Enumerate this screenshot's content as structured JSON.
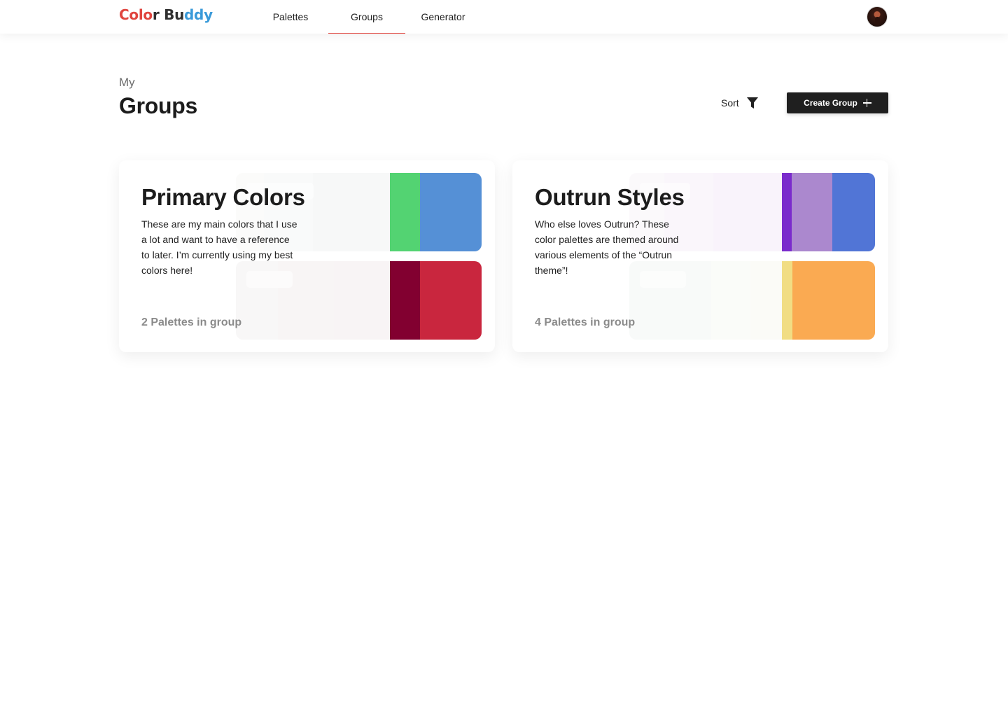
{
  "header": {
    "logo": [
      {
        "ch": "C",
        "color": "#e0453f"
      },
      {
        "ch": "o",
        "color": "#e0453f"
      },
      {
        "ch": "l",
        "color": "#e0453f"
      },
      {
        "ch": "o",
        "color": "#e0453f"
      },
      {
        "ch": "r",
        "color": "#2f2f2f"
      },
      {
        "ch": " ",
        "color": "#2f2f2f"
      },
      {
        "ch": "B",
        "color": "#2f2f2f"
      },
      {
        "ch": "u",
        "color": "#2f2f2f"
      },
      {
        "ch": "d",
        "color": "#3a9ad9"
      },
      {
        "ch": "d",
        "color": "#3a9ad9"
      },
      {
        "ch": "y",
        "color": "#3a9ad9"
      }
    ],
    "nav": {
      "palettes": "Palettes",
      "groups": "Groups",
      "generator": "Generator"
    },
    "active_tab": "Groups"
  },
  "page": {
    "kicker": "My",
    "title": "Groups",
    "sort_label": "Sort",
    "create_label": "Create Group"
  },
  "groups": [
    {
      "title": "Primary Colors",
      "description": "These are my main colors that I use a lot and want to have a reference to later. I’m currently using my best colors here!",
      "count": "2 Palettes in group",
      "palettes": [
        [
          "#fbfbfa",
          "#f9fafa",
          "#f7f8f8",
          "#53d372",
          "#5590d6"
        ],
        [
          "#f8f7f7",
          "#f8f5f5",
          "#f8f4f5",
          "#820030",
          "#c9263e"
        ]
      ]
    },
    {
      "title": "Outrun Styles",
      "description": "Who else loves Outrun? These color palettes are themed around various elements of the “Outrun theme”!",
      "count": "4 Palettes in group",
      "palettes": [
        [
          "#fbf9fb",
          "#faf6fb",
          "#f9f3fb",
          "#7a2bcc",
          "#ab88ce",
          "#5175d6"
        ],
        [
          "#f8faf9",
          "#fafcf9",
          "#fbfbf7",
          "#f1dd84",
          "#faaa52"
        ]
      ]
    }
  ]
}
